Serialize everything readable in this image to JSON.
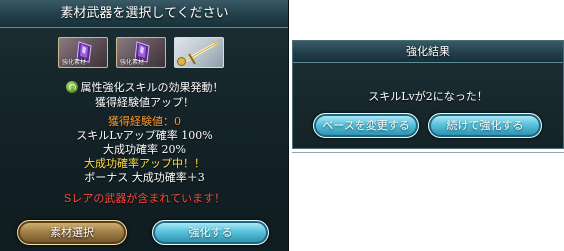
{
  "left_panel": {
    "title": "素材武器を選択してください",
    "slots": [
      {
        "label": "強化素材",
        "kind": "purple-crystal"
      },
      {
        "label": "強化素材",
        "kind": "purple-crystal"
      },
      {
        "label": "",
        "kind": "golden-sword"
      }
    ],
    "effect_text": "属性強化スキルの効果発動！",
    "exp_up_text": "獲得経験値アップ！",
    "exp_value_text": "獲得経験値：0",
    "skill_lv_up_text": "スキルLvアップ確率 100%",
    "great_success_text": "大成功確率 20%",
    "great_success_up_text": "大成功確率アップ中！！",
    "bonus_text": "ボーナス 大成功確率＋3",
    "warning_text": "Sレアの武器が含まれています！",
    "select_material_button": "素材選択",
    "enhance_button": "強化する"
  },
  "right_panel": {
    "title": "強化結果",
    "result_text": "スキルLvが2になった！",
    "change_base_button": "ベースを変更する",
    "continue_button": "続けて強化する"
  },
  "colors": {
    "panel_bg": "#142328",
    "header_bg": "#22404a",
    "orange_text": "#ff9a2e",
    "yellow_text": "#ffe040",
    "red_text": "#ff4a3a",
    "gold_button": "#a4824a",
    "teal_button": "#5bc4dc"
  }
}
